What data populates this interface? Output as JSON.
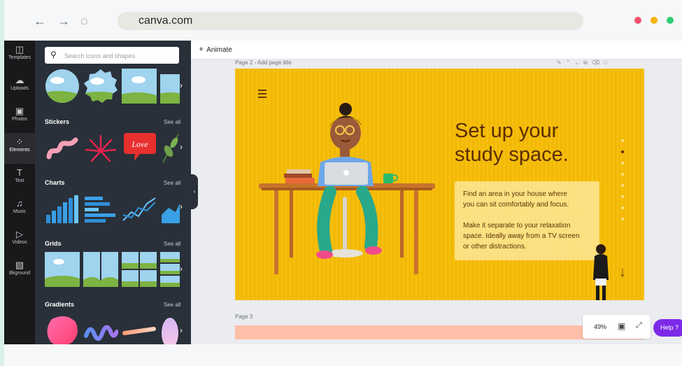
{
  "browser": {
    "url": "canva.com",
    "back_icon": "←",
    "forward_icon": "→",
    "reload_icon": "◌",
    "window_dot_colors": [
      "#f0526c",
      "#f4b400",
      "#2ecc71"
    ]
  },
  "rail": {
    "items": [
      {
        "label": "Templates",
        "icon": "◫"
      },
      {
        "label": "Uploads",
        "icon": "☁"
      },
      {
        "label": "Photos",
        "icon": "▣"
      },
      {
        "label": "Elements",
        "icon": "⁘"
      },
      {
        "label": "Text",
        "icon": "T"
      },
      {
        "label": "Music",
        "icon": "♫"
      },
      {
        "label": "Videos",
        "icon": "▷"
      },
      {
        "label": "Bkground",
        "icon": "▧"
      }
    ],
    "active": "Elements"
  },
  "panel": {
    "search_placeholder": "Search icons and shapes",
    "sections": [
      {
        "title": "Stickers",
        "see_all": "See all"
      },
      {
        "title": "Charts",
        "see_all": "See all"
      },
      {
        "title": "Grids",
        "see_all": "See all"
      },
      {
        "title": "Gradients",
        "see_all": "See all"
      }
    ],
    "sticker_love_text": "Love"
  },
  "topbar": {
    "animate_label": "Animate"
  },
  "canvas": {
    "page2_label": "Page 2 - Add page title",
    "page3_label": "Page 3",
    "slide": {
      "title_line1": "Set up your",
      "title_line2": "study space.",
      "para1_line1": "Find an area in your house where",
      "para1_line2": "you can sit comfortably and focus.",
      "para2_line1": "Make it separate to your relaxation",
      "para2_line2": "space. Ideally away from a TV screen",
      "para2_line3": "or other distractions.",
      "colors": {
        "background": "#f7bd05",
        "text": "#5b2d06"
      }
    }
  },
  "zoom": {
    "value": "49%"
  },
  "help": {
    "label": "Help ?"
  },
  "colors": {
    "accent_pink": "#e0136e",
    "help_purple": "#7d2ae8"
  }
}
